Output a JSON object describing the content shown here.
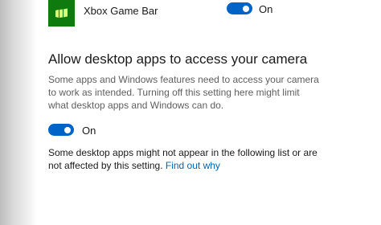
{
  "app": {
    "name": "Xbox Game Bar",
    "toggle_state": "On",
    "icon": "xbox-game-bar-icon"
  },
  "section": {
    "title": "Allow desktop apps to access your camera",
    "description": "Some apps and Windows features need to access your camera to work as intended. Turning off this setting here might limit what desktop apps and Windows can do.",
    "toggle_state": "On",
    "note": "Some desktop apps might not appear in the following list or are not affected by this setting. ",
    "link": "Find out why"
  },
  "colors": {
    "accent": "#0063c8",
    "app_icon_bg": "#0f7b0f",
    "link": "#0063b1",
    "secondary_text": "#5f5f5f"
  }
}
